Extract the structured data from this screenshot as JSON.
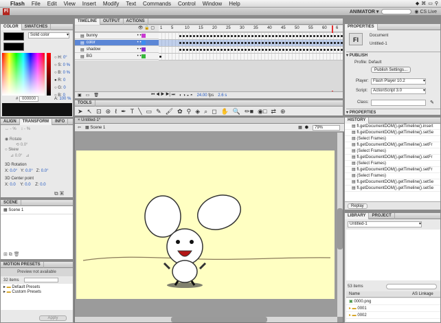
{
  "menubar": {
    "apple": "",
    "app": "Flash",
    "items": [
      "File",
      "Edit",
      "View",
      "Insert",
      "Modify",
      "Text",
      "Commands",
      "Control",
      "Window",
      "Help"
    ]
  },
  "titlebar": {
    "logo": "Fl",
    "workspace": "ANIMATOR",
    "cslive": "CS Live"
  },
  "timeline": {
    "tabs": [
      "TIMELINE",
      "OUTPUT",
      "ACTIONS"
    ],
    "frame_numbers": [
      "1",
      "5",
      "10",
      "15",
      "20",
      "25",
      "30",
      "35",
      "40",
      "45",
      "50",
      "55",
      "60",
      "6"
    ],
    "layers": [
      {
        "name": "bunny",
        "color": "#c93ad1"
      },
      {
        "name": "color",
        "color": "#3c8df0"
      },
      {
        "name": "shadow",
        "color": "#8a2fcf"
      },
      {
        "name": "BG",
        "color": "#38b93b"
      }
    ],
    "fps": "24.00",
    "fps_unit": "fps",
    "time": "2.6 s"
  },
  "tools": {
    "label": "TOOLS"
  },
  "color_panel": {
    "tabs": [
      "COLOR",
      "SWATCHES"
    ],
    "type": "Solid color",
    "h": "H:",
    "h_val": "0°",
    "s": "S:",
    "s_val": "0 %",
    "b": "B:",
    "b_val": "0 %",
    "r": "R:",
    "r_val": "0",
    "g": "G:",
    "g_val": "0",
    "bl": "B:",
    "bl_val": "0",
    "hex": "000000",
    "alpha": "A:",
    "alpha_val": "100 %"
  },
  "align_panel": {
    "tabs": [
      "ALIGN",
      "TRANSFORM",
      "INFO"
    ],
    "w": "%",
    "h": "%",
    "rotate": "Rotate",
    "rotate_val": "0.0°",
    "skew": "Skew",
    "skew_val1": "0.0°",
    "skew_val2": "",
    "rot3d": "3D Rotation",
    "x3d": "X:",
    "x3d_val": "0.0°",
    "y3d": "Y:",
    "y3d_val": "0.0°",
    "z3d": "Z:",
    "z3d_val": "0.0°",
    "center": "3D Center point",
    "cx": "X:",
    "cx_val": "0.0",
    "cy": "Y:",
    "cy_val": "0.0",
    "cz": "Z:",
    "cz_val": "0.0"
  },
  "scene_panel": {
    "title": "SCENE",
    "items": [
      "Scene 1"
    ]
  },
  "motion_presets": {
    "title": "MOTION PRESETS",
    "preview": "Preview not available",
    "count": "32 items",
    "folders": [
      "Default Presets",
      "Custom Presets"
    ],
    "apply": "Apply"
  },
  "document": {
    "tab": "Untitled-1*",
    "scene": "Scene 1",
    "zoom": "79%",
    "stage_color": "#ffffc2"
  },
  "properties": {
    "title": "PROPERTIES",
    "doc_icon": "Fl",
    "doc_type": "Document",
    "doc_name": "Untitled-1",
    "publish_header": "PUBLISH",
    "profile_label": "Profile:",
    "profile_val": "Default",
    "publish_settings": "Publish Settings...",
    "player_label": "Player:",
    "player_val": "Flash Player 10.2",
    "script_label": "Script:",
    "script_val": "ActionScript 3.0",
    "class_label": "Class:",
    "properties_header": "PROPERTIES"
  },
  "history": {
    "title": "HISTORY",
    "items": [
      "fl.getDocumentDOM().getTimeline().insert",
      "fl.getDocumentDOM().getTimeline().setSe",
      "(Select Frames)",
      "fl.getDocumentDOM().getTimeline().setFr",
      "(Select Frames)",
      "fl.getDocumentDOM().getTimeline().setFr",
      "(Select Frames)",
      "fl.getDocumentDOM().getTimeline().setFr",
      "(Select Frames)",
      "fl.getDocumentDOM().getTimeline().setSe",
      "fl.getDocumentDOM().getTimeline().setSe"
    ],
    "replay": "Replay"
  },
  "library": {
    "tabs": [
      "LIBRARY",
      "PROJECT"
    ],
    "doc": "Untitled-1",
    "count": "53 items",
    "col_name": "Name",
    "col_linkage": "AS Linkage",
    "items": [
      "0000.png",
      "0001",
      "0002"
    ]
  }
}
